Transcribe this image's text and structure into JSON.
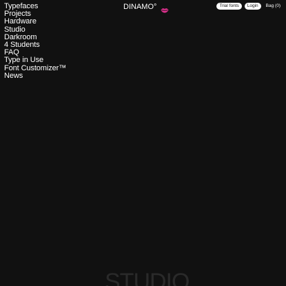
{
  "nav": {
    "items": [
      {
        "label": "Typefaces"
      },
      {
        "label": "Projects"
      },
      {
        "label": "Hardware"
      },
      {
        "label": "Studio"
      },
      {
        "label": "Darkroom"
      },
      {
        "label": "4 Students"
      },
      {
        "label": "FAQ"
      },
      {
        "label": "Type in Use"
      },
      {
        "label": "Font Customizer™"
      },
      {
        "label": "News"
      }
    ]
  },
  "brand": {
    "name": "DINAMO°",
    "icon": "lips-icon",
    "icon_color": "#e0318f"
  },
  "actions": {
    "trial_fonts_label": "Trial fonts",
    "login_label": "Login",
    "bag_label": "Bag (0)"
  },
  "hero": {
    "text": "STUDIO"
  },
  "colors": {
    "background": "#111111",
    "text": "#ffffff",
    "pill_bg": "#ffffff",
    "pill_text": "#111111"
  }
}
